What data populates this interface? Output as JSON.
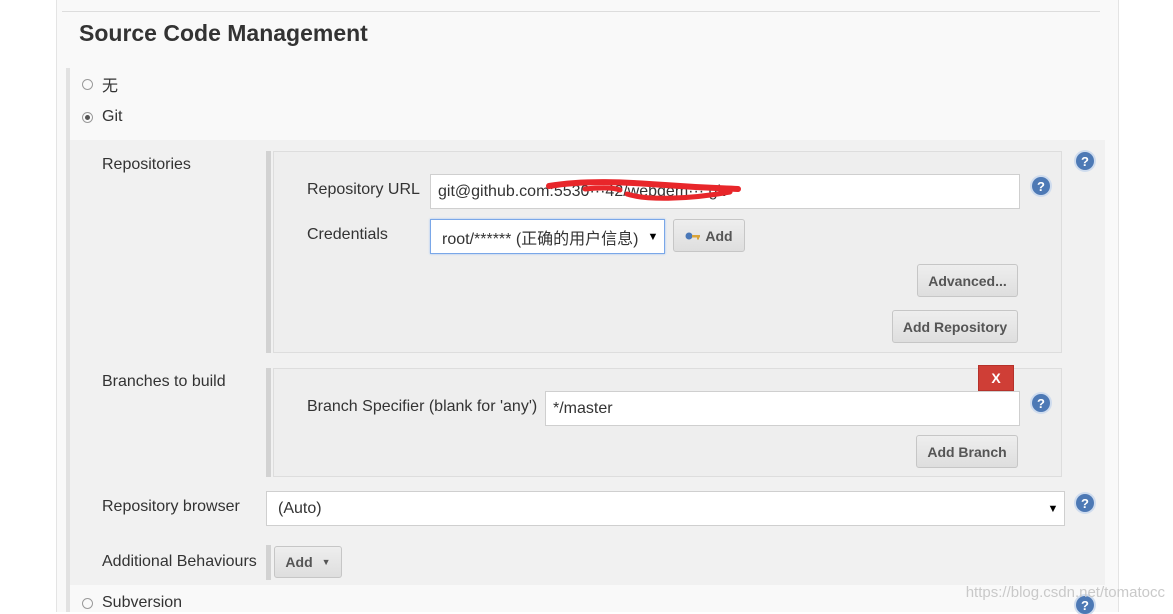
{
  "section": {
    "title": "Source Code Management"
  },
  "scm_options": {
    "none_label": "无",
    "git_label": "Git",
    "subversion_label": "Subversion",
    "selected": "Git"
  },
  "repositories": {
    "label": "Repositories",
    "url_label": "Repository URL",
    "url_value": "git@github.com:5530···42/webdem···.git",
    "credentials_label": "Credentials",
    "credentials_value": "root/****** (正确的用户信息)",
    "add_label": "Add",
    "advanced_label": "Advanced...",
    "add_repository_label": "Add Repository"
  },
  "branches": {
    "label": "Branches to build",
    "delete_label": "X",
    "specifier_label": "Branch Specifier (blank for 'any')",
    "specifier_value": "*/master",
    "add_branch_label": "Add Branch"
  },
  "repository_browser": {
    "label": "Repository browser",
    "value": "(Auto)"
  },
  "additional_behaviours": {
    "label": "Additional Behaviours",
    "add_label": "Add"
  },
  "help_icon_text": "?",
  "watermark": "https://blog.csdn.net/tomatocc",
  "colors": {
    "help_icon": "#4d79b5",
    "delete_button": "#cf3e36",
    "focus_border": "#7aa7e8",
    "redaction": "#e8262a"
  }
}
